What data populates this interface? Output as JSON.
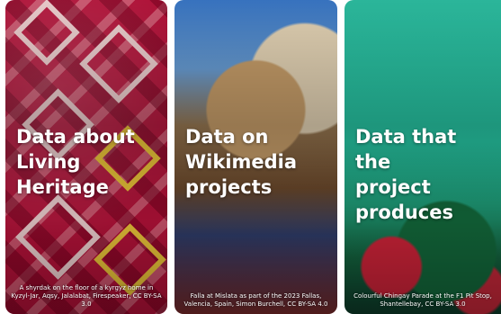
{
  "cards": [
    {
      "title": "Data about\nLiving\nHeritage",
      "caption": "A shyrdak on the floor of a kyrgyz home in Kyzyl-Jar, Aqsy, Jalalabat, Firespeaker, CC BY-SA 3.0",
      "color": "#b8123a"
    },
    {
      "title": "Data on\nWikimedia\nprojects",
      "caption": "Falla at Mislata as part of the 2023 Fallas, Valencia, Spain, Simon Burchell, CC BY-SA 4.0",
      "color": "#2f3d6b"
    },
    {
      "title": "Data that the\nproject\nproduces",
      "caption": "Colourful Chingay Parade at the F1 Pit Stop, Shantellebay, CC BY-SA 3.0",
      "color": "#27c9a6"
    }
  ]
}
